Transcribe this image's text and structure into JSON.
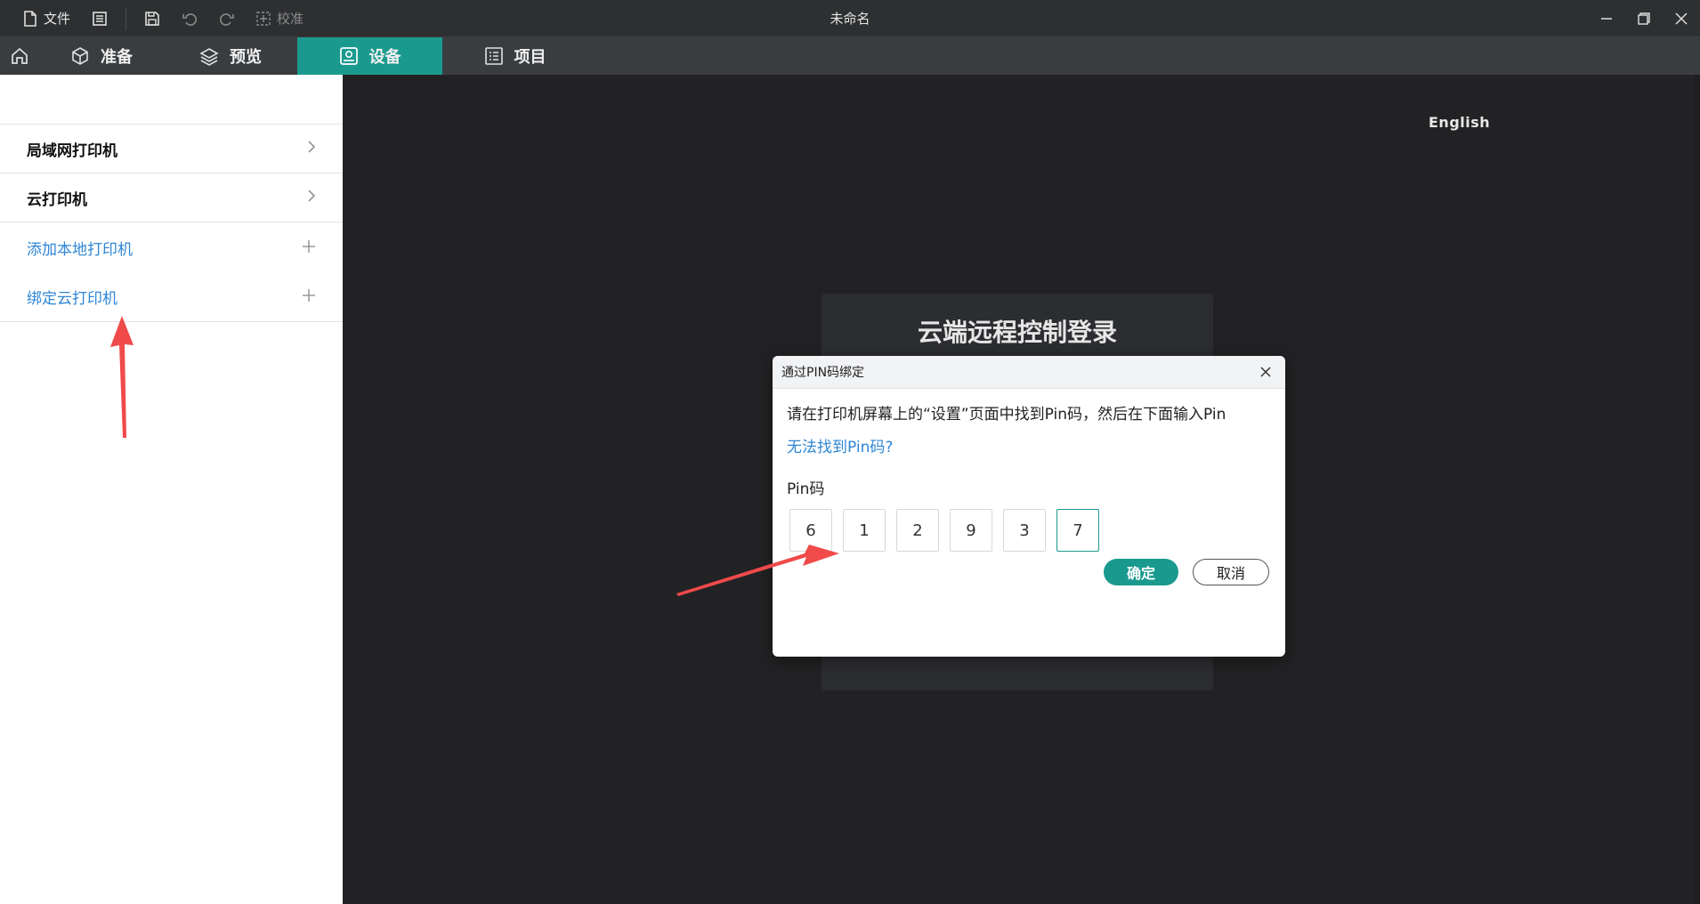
{
  "titlebar": {
    "file_label": "文件",
    "calibrate_label": "校准",
    "window_title": "未命名"
  },
  "nav": {
    "tabs": [
      {
        "label": "准备",
        "icon": "cube-icon"
      },
      {
        "label": "预览",
        "icon": "layers-icon"
      },
      {
        "label": "设备",
        "icon": "device-icon",
        "active": true
      },
      {
        "label": "项目",
        "icon": "list-icon"
      }
    ]
  },
  "sidebar": {
    "items": [
      {
        "label": "局域网打印机",
        "type": "expand"
      },
      {
        "label": "云打印机",
        "type": "expand"
      },
      {
        "label": "添加本地打印机",
        "type": "add"
      },
      {
        "label": "绑定云打印机",
        "type": "add"
      }
    ]
  },
  "main": {
    "language_label": "English",
    "login_title": "云端远程控制登录"
  },
  "dialog": {
    "title": "通过PIN码绑定",
    "description": "请在打印机屏幕上的“设置”页面中找到Pin码，然后在下面输入Pin",
    "help_link": "无法找到Pin码?",
    "pin_label": "Pin码",
    "pin_digits": [
      "6",
      "1",
      "2",
      "9",
      "3",
      "7"
    ],
    "ok_label": "确定",
    "cancel_label": "取消"
  },
  "colors": {
    "accent": "#1a9a8e",
    "link": "#2f86d6",
    "annotation_arrow": "#f04a4a"
  }
}
